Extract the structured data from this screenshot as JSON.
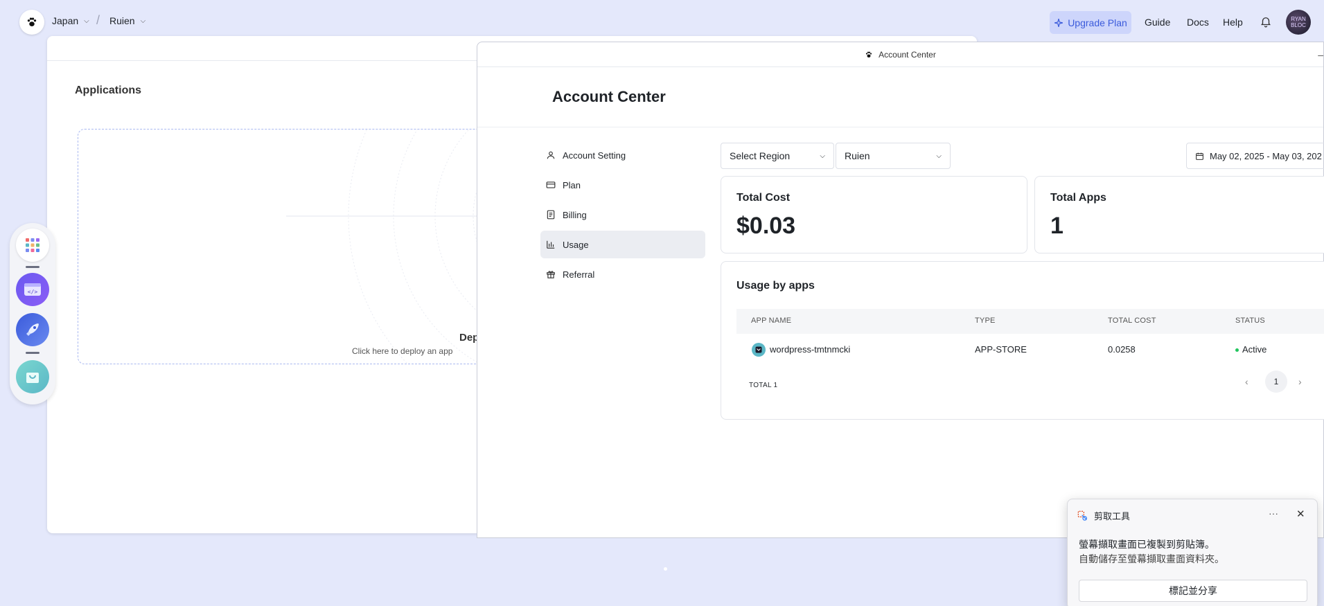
{
  "topbar": {
    "region": "Japan",
    "workspace": "Ruien",
    "upgrade_label": "Upgrade Plan",
    "nav": [
      "Guide",
      "Docs",
      "Help"
    ],
    "avatar_text": "RYAN BLOC"
  },
  "background": {
    "apps_title": "Applications",
    "deploy_title": "Dep",
    "deploy_subtitle": "Click here to deploy an app"
  },
  "account_center": {
    "window_title": "Account Center",
    "heading": "Account Center",
    "menu": [
      {
        "label": "Account Setting",
        "icon": "user-icon"
      },
      {
        "label": "Plan",
        "icon": "card-icon"
      },
      {
        "label": "Billing",
        "icon": "document-icon"
      },
      {
        "label": "Usage",
        "icon": "bar-chart-icon",
        "active": true
      },
      {
        "label": "Referral",
        "icon": "gift-icon"
      }
    ],
    "region_select": "Select Region",
    "workspace_select": "Ruien",
    "date_range": "May 02, 2025 - May 03, 202",
    "total_cost_label": "Total Cost",
    "total_cost_value": "$0.03",
    "total_apps_label": "Total Apps",
    "total_apps_value": "1",
    "usage": {
      "title": "Usage by apps",
      "columns": [
        "APP NAME",
        "TYPE",
        "TOTAL COST",
        "STATUS"
      ],
      "rows": [
        {
          "app_name": "wordpress-tmtnmcki",
          "type": "APP-STORE",
          "total_cost": "0.0258",
          "status": "Active"
        }
      ],
      "total_label": "TOTAL 1",
      "page": "1"
    }
  },
  "toast": {
    "app_name": "剪取工具",
    "line1": "螢幕擷取畫面已複製到剪貼簿。",
    "line2": "自動儲存至螢幕擷取畫面資料夾。",
    "button": "標記並分享",
    "more": "···",
    "close": "✕"
  },
  "colors": {
    "background": "#e4e8fb",
    "accent": "#3b5bdb",
    "upgrade_bg": "#cdd5fb",
    "status_active": "#22c55e"
  }
}
